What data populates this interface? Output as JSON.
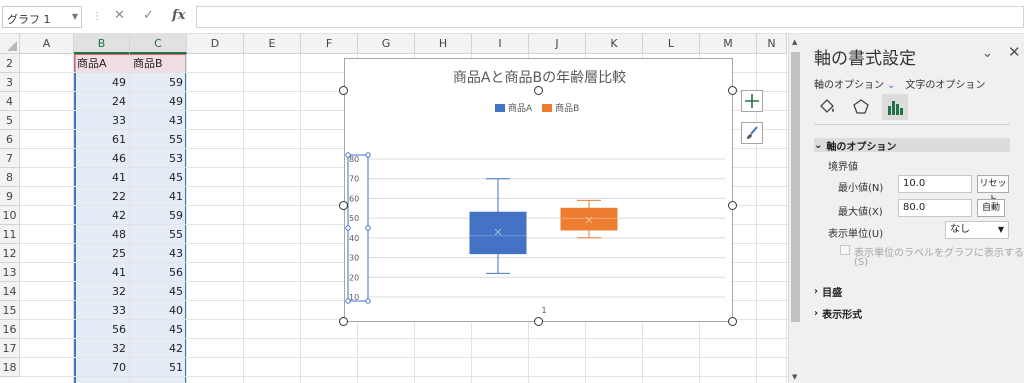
{
  "formula_bar": {
    "name_box": "グラフ 1",
    "fx": "fx",
    "cancel_glyph": "✕",
    "enter_glyph": "✓",
    "formula": ""
  },
  "grid": {
    "columns": [
      "A",
      "B",
      "C",
      "D",
      "E",
      "F",
      "G",
      "H",
      "I",
      "J",
      "K",
      "L",
      "M",
      "N"
    ],
    "rows": [
      "2",
      "3",
      "4",
      "5",
      "6",
      "7",
      "8",
      "9",
      "10",
      "11",
      "12",
      "13",
      "14",
      "15",
      "16",
      "17",
      "18"
    ],
    "header_row": [
      "商品A",
      "商品B"
    ],
    "data": [
      [
        49,
        59
      ],
      [
        24,
        49
      ],
      [
        33,
        43
      ],
      [
        61,
        55
      ],
      [
        46,
        53
      ],
      [
        41,
        45
      ],
      [
        22,
        41
      ],
      [
        42,
        59
      ],
      [
        48,
        55
      ],
      [
        25,
        43
      ],
      [
        41,
        56
      ],
      [
        32,
        45
      ],
      [
        33,
        40
      ],
      [
        56,
        45
      ],
      [
        32,
        42
      ],
      [
        70,
        51
      ]
    ]
  },
  "chart": {
    "title": "商品Aと商品Bの年齢層比較",
    "legend": [
      {
        "name": "商品A",
        "color": "#4472c4"
      },
      {
        "name": "商品B",
        "color": "#ed7d31"
      }
    ],
    "add_element_icon": "plus-icon",
    "style_icon": "brush-icon",
    "x_tick": "1"
  },
  "chart_data": {
    "type": "box",
    "title": "商品Aと商品Bの年齢層比較",
    "categories": [
      "1"
    ],
    "ylim": [
      10,
      80
    ],
    "yticks": [
      10,
      20,
      30,
      40,
      50,
      60,
      70,
      80
    ],
    "series": [
      {
        "name": "商品A",
        "color": "#4472c4",
        "min": 22,
        "q1": 32,
        "median": 41,
        "q3": 53,
        "max": 70,
        "mean": 43
      },
      {
        "name": "商品B",
        "color": "#ed7d31",
        "min": 40,
        "q1": 44,
        "median": 50,
        "q3": 55,
        "max": 59,
        "mean": 49
      }
    ],
    "grid": true,
    "legend_position": "top"
  },
  "pane": {
    "title": "軸の書式設定",
    "tab_axis_options": "軸のオプション",
    "tab_text_options": "文字のオプション",
    "section_axis_options": "軸のオプション",
    "bounds_label": "境界値",
    "min_label": "最小値(N)",
    "min_value": "10.0",
    "min_button": "リセット",
    "max_label": "最大値(X)",
    "max_value": "80.0",
    "max_button": "自動",
    "display_unit_label": "表示単位(U)",
    "display_unit_value": "なし",
    "show_unit_label": "表示単位のラベルをグラフに表示する",
    "show_unit_label_shortcut": "(S)",
    "section_ticks": "目盛",
    "section_number": "表示形式"
  }
}
